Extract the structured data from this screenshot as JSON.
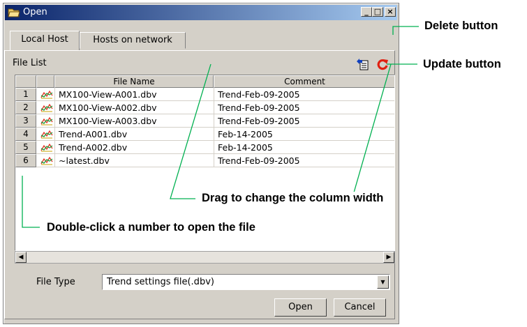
{
  "window": {
    "title": "Open",
    "tabs": [
      "Local Host",
      "Hosts on network"
    ],
    "section_label": "File List",
    "columns": {
      "file_name": "File Name",
      "comment": "Comment"
    },
    "files": [
      {
        "num": "1",
        "name": "MX100-View-A001.dbv",
        "comment": "Trend-Feb-09-2005"
      },
      {
        "num": "2",
        "name": "MX100-View-A002.dbv",
        "comment": "Trend-Feb-09-2005"
      },
      {
        "num": "3",
        "name": "MX100-View-A003.dbv",
        "comment": "Trend-Feb-09-2005"
      },
      {
        "num": "4",
        "name": "Trend-A001.dbv",
        "comment": "Feb-14-2005"
      },
      {
        "num": "5",
        "name": "Trend-A002.dbv",
        "comment": "Feb-14-2005"
      },
      {
        "num": "6",
        "name": "~latest.dbv",
        "comment": "Trend-Feb-09-2005"
      }
    ],
    "file_type_label": "File Type",
    "file_type_value": "Trend settings file(.dbv)",
    "buttons": {
      "open": "Open",
      "cancel": "Cancel"
    }
  },
  "callouts": {
    "delete": "Delete button",
    "update": "Update button",
    "drag": "Drag to change the column width",
    "double_click": "Double-click a number to open the file"
  },
  "colors": {
    "accent_line": "#00b050",
    "update_icon": "#e02010",
    "titlebar": "#0a246a"
  }
}
